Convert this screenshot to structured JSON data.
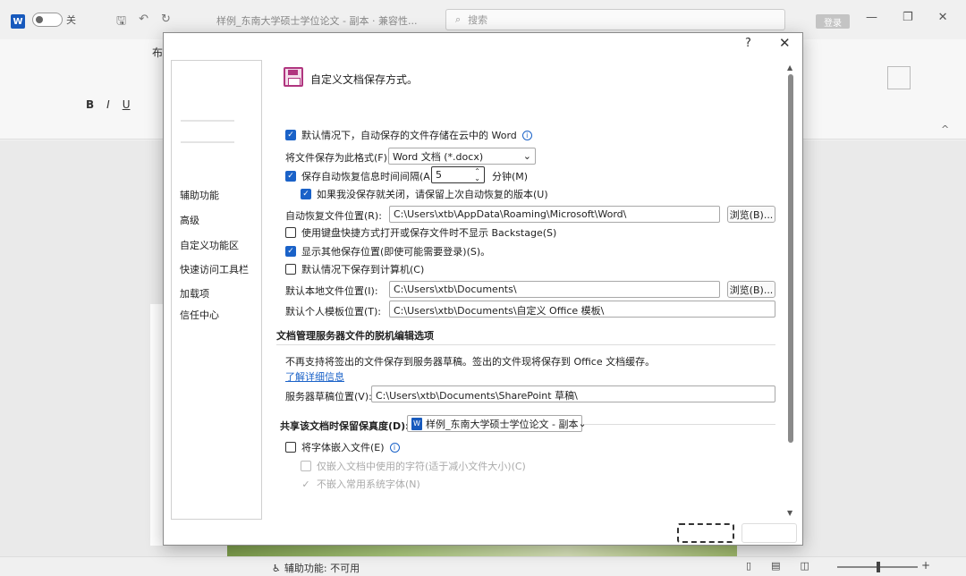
{
  "titlebar": {
    "app_letter": "W",
    "autosave_state": "关",
    "doc_title": "样例_东南大学硕士学位论文 - 副本 · 兼容性...",
    "search_placeholder": "搜索",
    "login_label": "登录",
    "qat_icons": [
      "save-icon",
      "undo-icon",
      "redo-icon"
    ]
  },
  "ribbon": {
    "tab_label": "布",
    "fmt_bold": "B",
    "fmt_italic": "I",
    "fmt_underline": "U",
    "collapse_glyph": "^"
  },
  "dialog": {
    "help": "?",
    "close": "✕",
    "nav": [
      "辅助功能",
      "高级",
      "自定义功能区",
      "快速访问工具栏",
      "加载项",
      "信任中心"
    ],
    "header": "自定义文档保存方式。",
    "options": {
      "cloud_autosave": "默认情况下，自动保存的文件存储在云中的 Word",
      "save_format_label": "将文件保存为此格式(F):",
      "save_format_value": "Word 文档 (*.docx)",
      "autorecover_label": "保存自动恢复信息时间间隔(A)",
      "autorecover_minutes": "5",
      "minutes_unit": "分钟(M)",
      "keep_last_version": "如果我没保存就关闭，请保留上次自动恢复的版本(U)",
      "autorecover_location_label": "自动恢复文件位置(R):",
      "autorecover_location_value": "C:\\Users\\xtb\\AppData\\Roaming\\Microsoft\\Word\\",
      "browse1": "浏览(B)...",
      "no_backstage": "使用键盘快捷方式打开或保存文件时不显示 Backstage(S)",
      "show_other_locations": "显示其他保存位置(即使可能需要登录)(S)。",
      "save_to_computer": "默认情况下保存到计算机(C)",
      "local_location_label": "默认本地文件位置(I):",
      "local_location_value": "C:\\Users\\xtb\\Documents\\",
      "browse2": "浏览(B)...",
      "template_location_label": "默认个人模板位置(T):",
      "template_location_value": "C:\\Users\\xtb\\Documents\\自定义 Office 模板\\"
    },
    "offline": {
      "title": "文档管理服务器文件的脱机编辑选项",
      "notice": "不再支持将签出的文件保存到服务器草稿。签出的文件现将保存到 Office 文档缓存。",
      "learn_more": "了解详细信息",
      "drafts_label": "服务器草稿位置(V):",
      "drafts_value": "C:\\Users\\xtb\\Documents\\SharePoint 草稿\\"
    },
    "fidelity": {
      "title": "共享该文档时保留保真度(D):",
      "doc_value": "样例_东南大学硕士学位论文 - 副本",
      "embed_fonts": "将字体嵌入文件(E)",
      "embed_used_only": "仅嵌入文档中使用的字符(适于减小文件大小)(C)",
      "no_common_fonts": "不嵌入常用系统字体(N)"
    }
  },
  "statusbar": {
    "accessibility": "辅助功能: 不可用"
  }
}
